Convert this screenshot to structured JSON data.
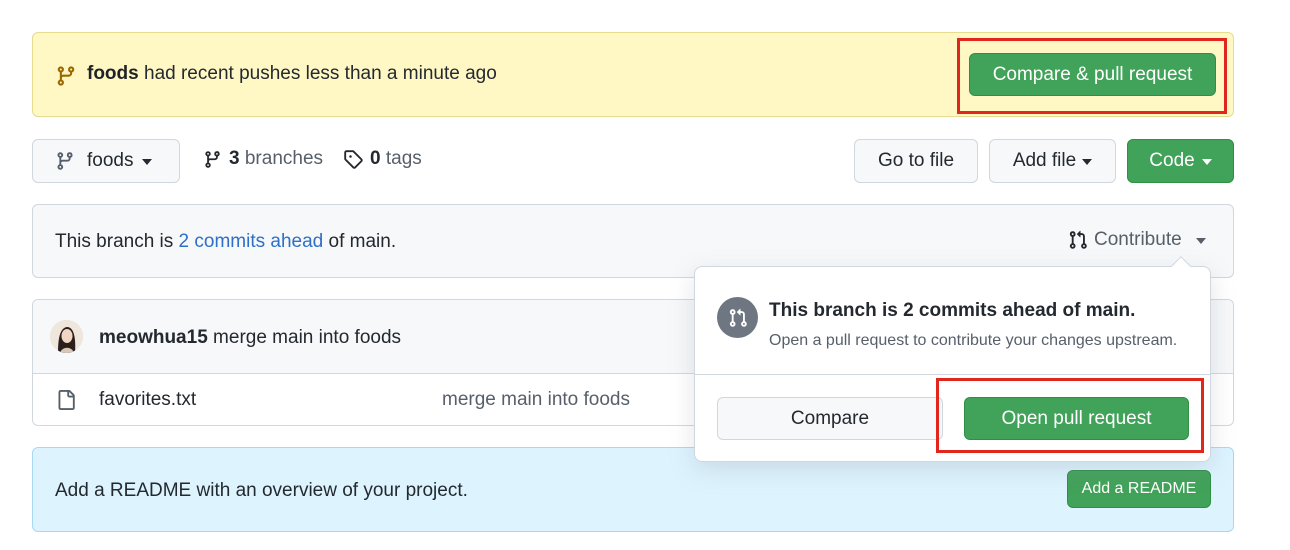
{
  "banner": {
    "branch": "foods",
    "message": " had recent pushes less than a minute ago",
    "button": "Compare & pull request"
  },
  "toolbar": {
    "branch": "foods",
    "branches_count": "3",
    "branches_label": "branches",
    "tags_count": "0",
    "tags_label": "tags",
    "go_to_file": "Go to file",
    "add_file": "Add file",
    "code": "Code"
  },
  "ahead": {
    "prefix": "This branch is ",
    "link": "2 commits ahead",
    "suffix": " of main.",
    "contribute": "Contribute"
  },
  "commit": {
    "author": "meowhua15",
    "message": " merge main into foods"
  },
  "files": [
    {
      "name": "favorites.txt",
      "message": "merge main into foods"
    }
  ],
  "readme": {
    "text": "Add a README with an overview of your project.",
    "button": "Add a README"
  },
  "popover": {
    "title": "This branch is 2 commits ahead of main.",
    "subtitle": "Open a pull request to contribute your changes upstream.",
    "compare": "Compare",
    "open_pr": "Open pull request"
  },
  "colors": {
    "green": "#41a259",
    "link": "#2f6fc7",
    "highlight": "#e0261d",
    "banner_bg": "#fff8c5",
    "readme_bg": "#ddf4ff"
  }
}
